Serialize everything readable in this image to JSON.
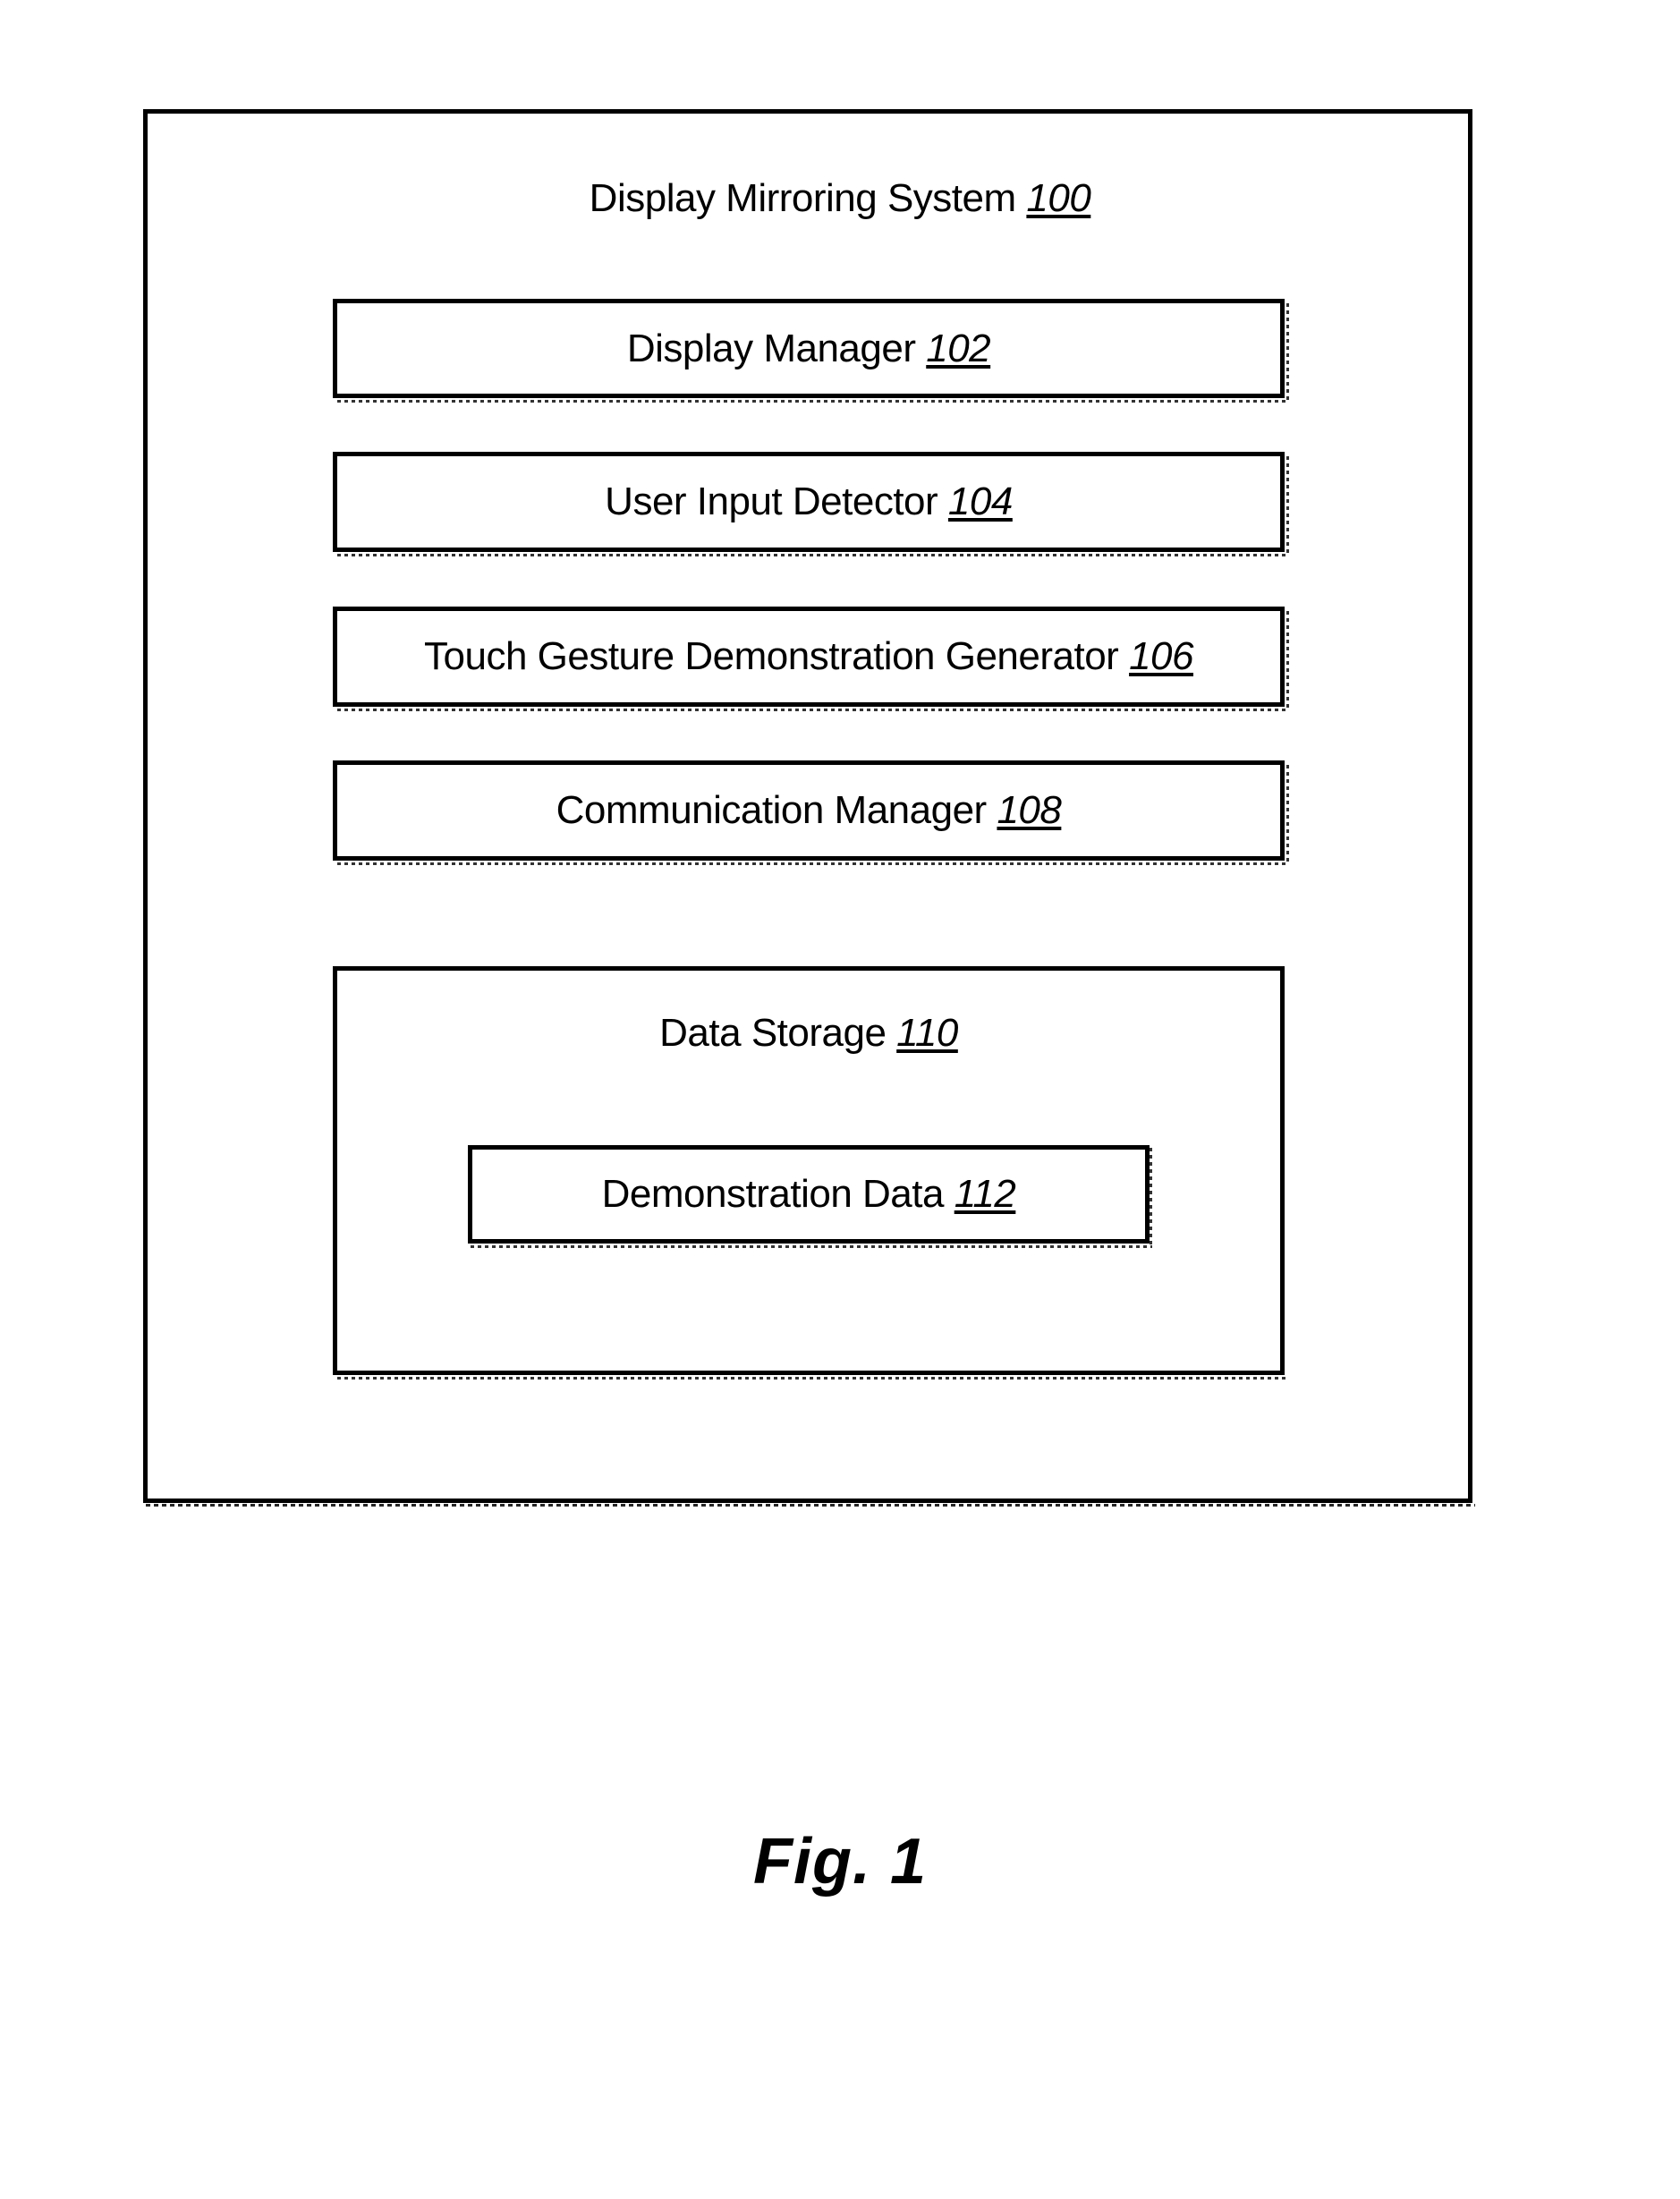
{
  "figure": {
    "caption": "Fig. 1",
    "page_background": "#ffffff",
    "line_color": "#000000"
  },
  "system": {
    "title_text": "Display Mirroring System",
    "title_ref": "100"
  },
  "components": [
    {
      "label": "Display Manager",
      "ref": "102"
    },
    {
      "label": "User Input Detector",
      "ref": "104"
    },
    {
      "label": "Touch Gesture Demonstration Generator",
      "ref": "106"
    },
    {
      "label": "Communication Manager",
      "ref": "108"
    }
  ],
  "storage": {
    "label": "Data Storage",
    "ref": "110",
    "inner": {
      "label": "Demonstration Data",
      "ref": "112"
    }
  }
}
